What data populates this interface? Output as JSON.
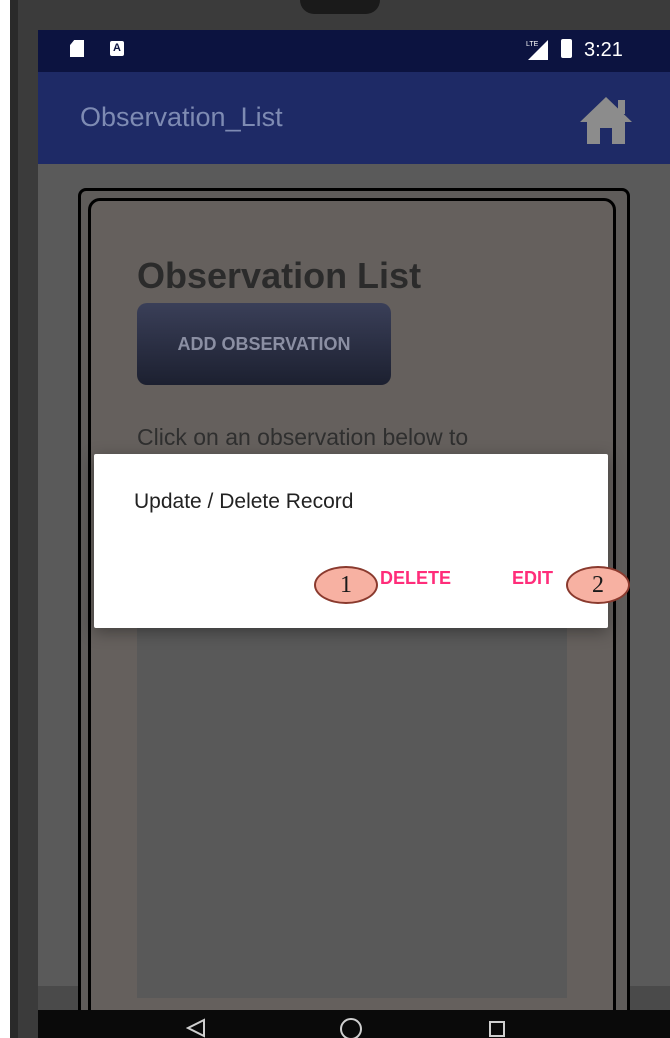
{
  "status_bar": {
    "time": "3:21",
    "icons": [
      "sd-card-icon",
      "a-notification-icon",
      "lte-signal-icon",
      "battery-icon"
    ],
    "a_icon_letter": "A"
  },
  "app_bar": {
    "title": "Observation_List",
    "home_icon": "home-icon"
  },
  "main": {
    "heading": "Observation List",
    "add_button_label": "ADD OBSERVATION",
    "hint": "Click on an observation below to"
  },
  "dialog": {
    "title": "Update / Delete Record",
    "delete_label": "DELETE",
    "edit_label": "EDIT"
  },
  "annotations": {
    "callout_1": "1",
    "callout_2": "2"
  },
  "nav_bar": {
    "icons": [
      "back-icon",
      "home-circle-icon",
      "recent-apps-icon"
    ]
  },
  "colors": {
    "status_bar": "#0c1340",
    "app_bar": "#1e2a66",
    "accent_pink": "#ff2d7a",
    "callout_fill": "#f7b1a2"
  }
}
